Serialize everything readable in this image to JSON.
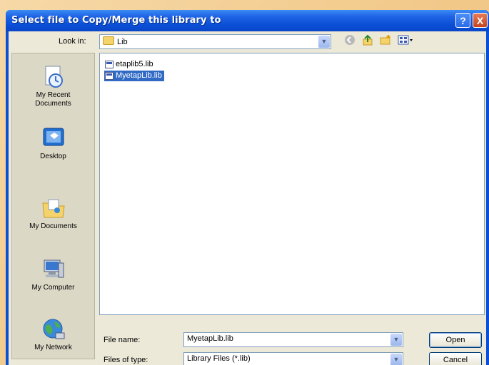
{
  "window": {
    "title": "Select file to Copy/Merge this library to"
  },
  "titlebar_buttons": {
    "help": "?",
    "close": "X"
  },
  "lookin": {
    "label": "Look in:",
    "value": "Lib"
  },
  "toolbar": {
    "back_icon": "back-icon",
    "up_icon": "up-folder-icon",
    "new_folder_icon": "new-folder-icon",
    "views_icon": "views-menu-icon"
  },
  "places": [
    {
      "label": "My Recent\nDocuments",
      "icon": "recent-documents-icon"
    },
    {
      "label": "Desktop",
      "icon": "desktop-icon"
    },
    {
      "label": "My Documents",
      "icon": "my-documents-icon"
    },
    {
      "label": "My Computer",
      "icon": "my-computer-icon"
    },
    {
      "label": "My Network",
      "icon": "my-network-icon"
    }
  ],
  "files": [
    {
      "name": "etaplib5.lib",
      "selected": false
    },
    {
      "name": "MyetapLib.lib",
      "selected": true
    }
  ],
  "filename": {
    "label": "File name:",
    "value": "MyetapLib.lib"
  },
  "filetype": {
    "label": "Files of type:",
    "value": "Library Files (*.lib)"
  },
  "buttons": {
    "open": "Open",
    "cancel": "Cancel"
  }
}
